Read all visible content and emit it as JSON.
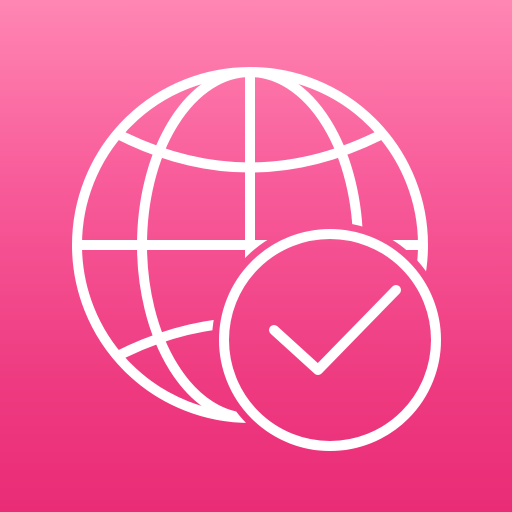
{
  "icon": {
    "name": "globe-check",
    "background": {
      "top_color": "#ff86b3",
      "bottom_color": "#ea2c76"
    },
    "glyph_color": "#ffffff",
    "symbols": [
      "globe-icon",
      "check-badge-icon",
      "checkmark-icon"
    ]
  }
}
